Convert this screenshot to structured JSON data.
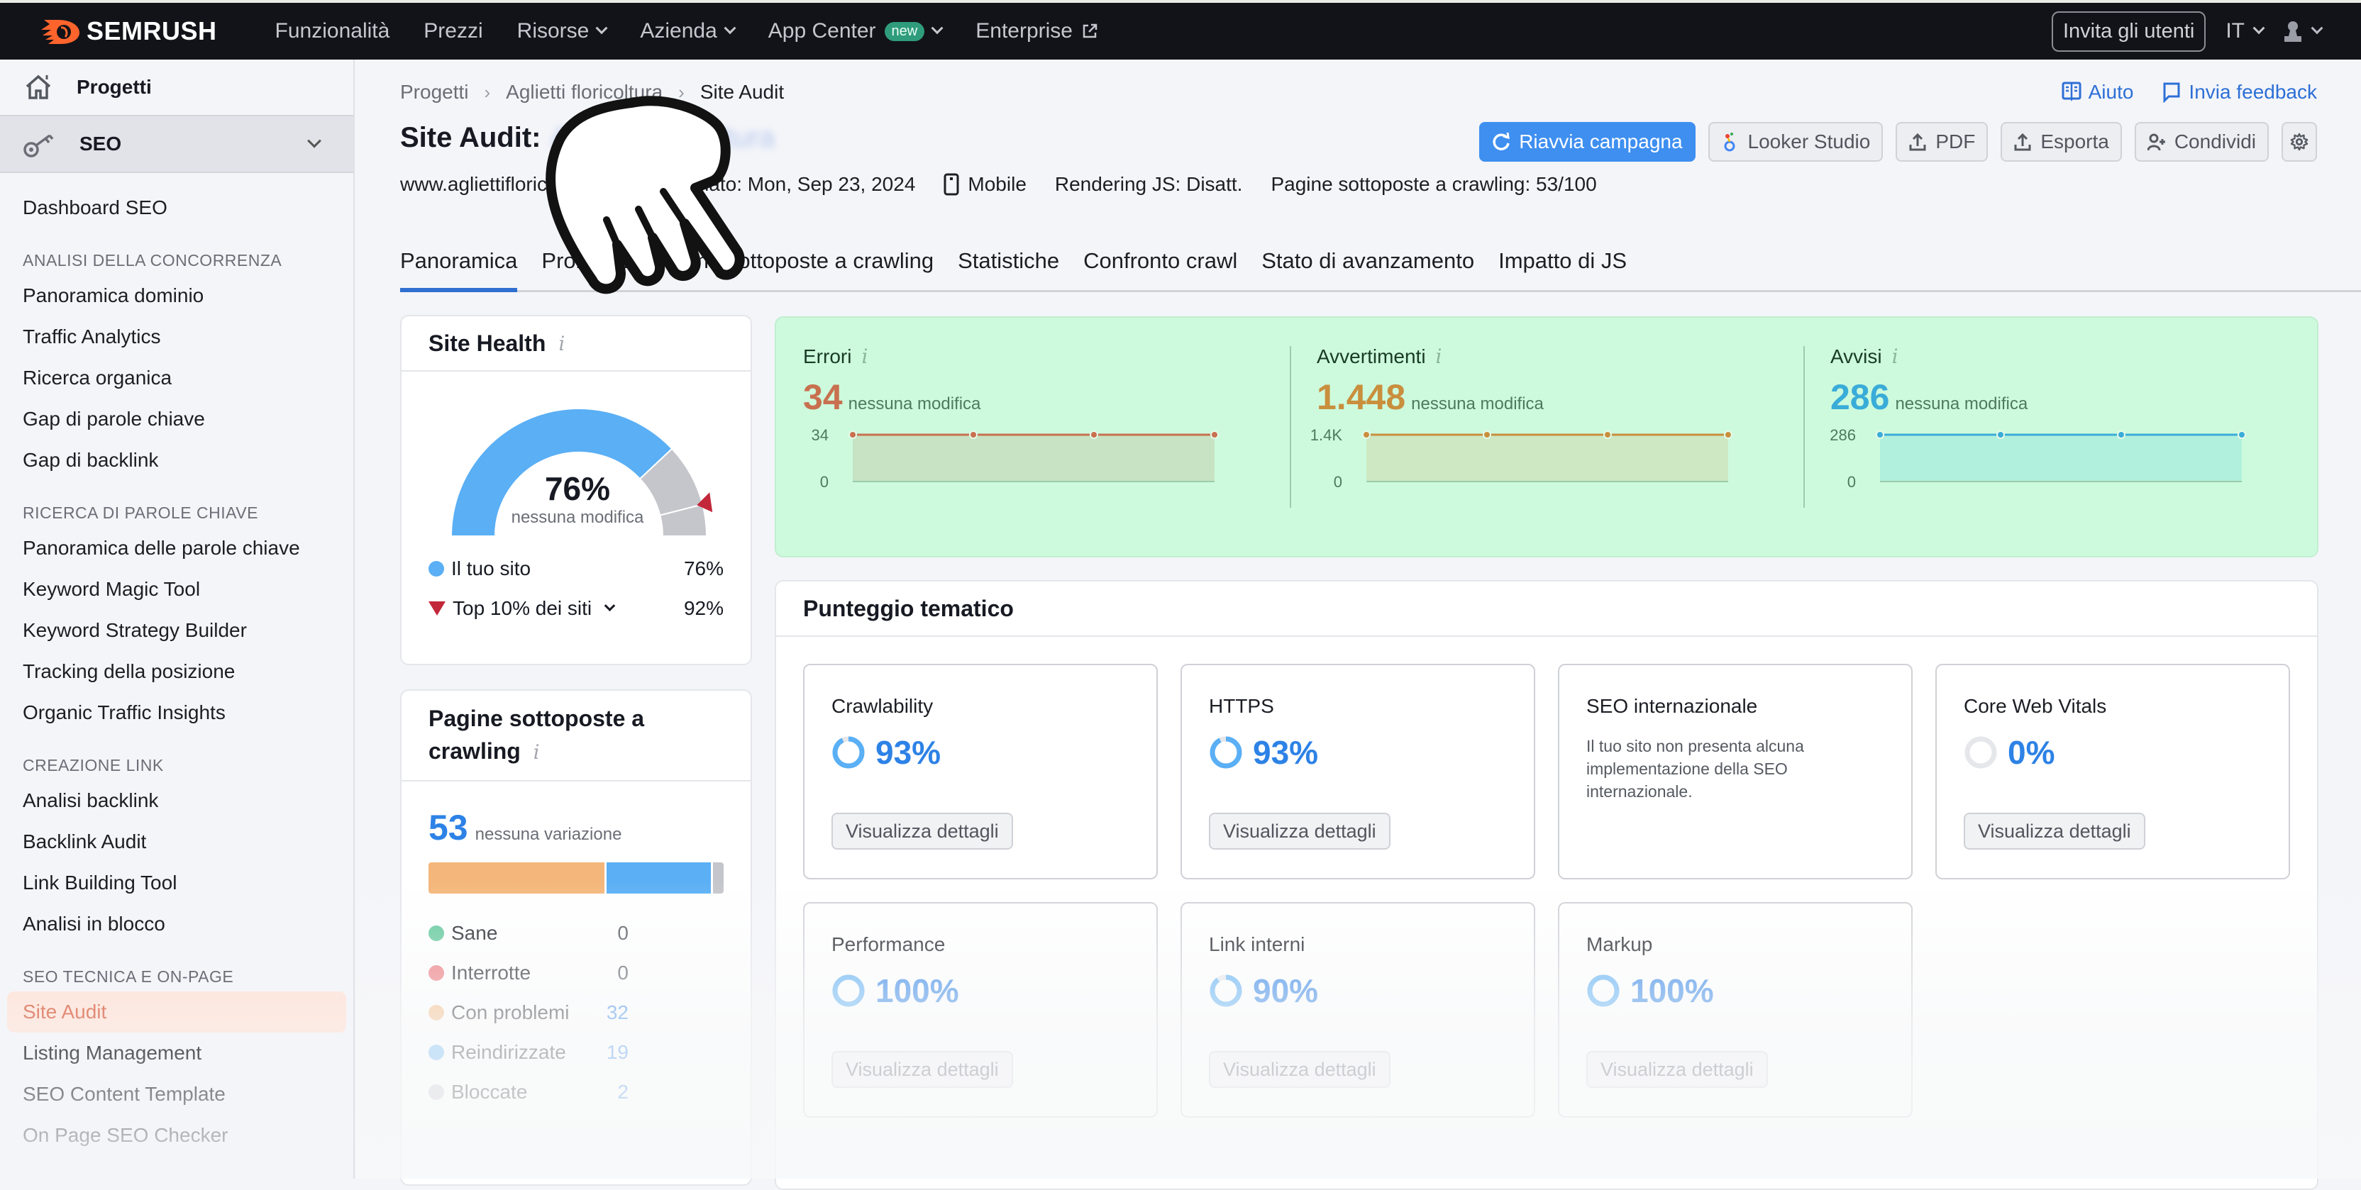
{
  "topnav": {
    "brand": "SEMRUSH",
    "brand_color": "#ff642d",
    "items": [
      {
        "label": "Funzionalità",
        "dropdown": false
      },
      {
        "label": "Prezzi",
        "dropdown": false
      },
      {
        "label": "Risorse",
        "dropdown": true
      },
      {
        "label": "Azienda",
        "dropdown": true
      },
      {
        "label": "App Center",
        "dropdown": true,
        "badge": "new"
      },
      {
        "label": "Enterprise",
        "external": true
      }
    ],
    "invite_label": "Invita gli utenti",
    "language": "IT",
    "user_icon": "user-icon"
  },
  "sidebar": {
    "projects_label": "Progetti",
    "seo_label": "SEO",
    "dashboard": "Dashboard SEO",
    "sections": [
      {
        "title": "ANALISI DELLA CONCORRENZA",
        "items": [
          "Panoramica dominio",
          "Traffic Analytics",
          "Ricerca organica",
          "Gap di parole chiave",
          "Gap di backlink"
        ]
      },
      {
        "title": "RICERCA DI PAROLE CHIAVE",
        "items": [
          "Panoramica delle parole chiave",
          "Keyword Magic Tool",
          "Keyword Strategy Builder",
          "Tracking della posizione",
          "Organic Traffic Insights"
        ]
      },
      {
        "title": "CREAZIONE LINK",
        "items": [
          "Analisi backlink",
          "Backlink Audit",
          "Link Building Tool",
          "Analisi in blocco"
        ]
      },
      {
        "title": "SEO TECNICA E ON-PAGE",
        "items": [
          "Site Audit",
          "Listing Management",
          "SEO Content Template",
          "On Page SEO Checker"
        ]
      }
    ],
    "active_item": "Site Audit",
    "active_color": "#e0826a"
  },
  "header": {
    "breadcrumb": [
      "Progetti",
      "Aglietti floricoltura",
      "Site Audit"
    ],
    "help_label": "Aiuto",
    "feedback_label": "Invia feedback",
    "title_prefix": "Site Audit:",
    "title_project": "Aglietti floricoltura",
    "domain": "www.agliettifloricoltura.it",
    "updated": "Aggiornato: Mon, Sep 23, 2024",
    "device": "Mobile",
    "js_rendering": "Rendering JS: Disatt.",
    "crawled_pages": "Pagine sottoposte a crawling: 53/100",
    "actions": {
      "restart": "Riavvia campagna",
      "looker": "Looker Studio",
      "pdf": "PDF",
      "export": "Esporta",
      "share": "Condividi"
    },
    "primary_color": "#3e8ff0"
  },
  "tabs": [
    "Panoramica",
    "Problemi",
    "Pagine sottoposte a crawling",
    "Statistiche",
    "Confronto crawl",
    "Stato di avanzamento",
    "Impatto di JS"
  ],
  "active_tab": 0,
  "site_health": {
    "title": "Site Health",
    "value": "76%",
    "value_fraction": 0.76,
    "top10_fraction": 0.92,
    "change": "nessuna modifica",
    "legend": [
      {
        "label": "Il tuo sito",
        "value": "76%"
      },
      {
        "label": "Top 10% dei siti",
        "value": "92%"
      }
    ],
    "colors": {
      "site": "#5aaff5",
      "rest": "#c5c6cb",
      "marker": "#c2283a"
    }
  },
  "crawled": {
    "title": "Pagine sottoposte a crawling",
    "total": "53",
    "change": "nessuna variazione",
    "rows": [
      {
        "label": "Sane",
        "value": 0,
        "color": "#5fc79a",
        "value_color": "#555960"
      },
      {
        "label": "Interrotte",
        "value": 0,
        "color": "#ee7278",
        "value_color": "#555960"
      },
      {
        "label": "Con problemi",
        "value": 32,
        "color": "#f4b67a",
        "value_color": "#2d82e6"
      },
      {
        "label": "Reindirizzate",
        "value": 19,
        "color": "#5aaff5",
        "value_color": "#2d82e6"
      },
      {
        "label": "Bloccate",
        "value": 2,
        "color": "#c5c6cb",
        "value_color": "#2d82e6"
      }
    ]
  },
  "issues": [
    {
      "title": "Errori",
      "count": "34",
      "change": "nessuna modifica",
      "color": "#c8704f",
      "fill": "#c7e3c3",
      "ticks": [
        "34",
        "0"
      ],
      "points": [
        34,
        34,
        34,
        34
      ],
      "max": 34
    },
    {
      "title": "Avvertimenti",
      "count": "1.448",
      "change": "nessuna modifica",
      "color": "#c98f3d",
      "fill": "#cde8c2",
      "ticks": [
        "1.4K",
        "0"
      ],
      "points": [
        1448,
        1448,
        1448,
        1448
      ],
      "max": 1448
    },
    {
      "title": "Avvisi",
      "count": "286",
      "change": "nessuna modifica",
      "color": "#3aacd8",
      "fill": "#b1f0dd",
      "ticks": [
        "286",
        "0"
      ],
      "points": [
        286,
        286,
        286,
        286
      ],
      "max": 286
    }
  ],
  "thematic": {
    "title": "Punteggio tematico",
    "details_label": "Visualizza dettagli",
    "items": [
      {
        "name": "Crawlability",
        "score": "93%",
        "fraction": 0.93
      },
      {
        "name": "HTTPS",
        "score": "93%",
        "fraction": 0.93
      },
      {
        "name": "SEO internazionale",
        "description": "Il tuo sito non presenta alcuna implementazione della SEO internazionale."
      },
      {
        "name": "Core Web Vitals",
        "score": "0%",
        "fraction": 0
      },
      {
        "name": "Performance",
        "score": "100%",
        "fraction": 1
      },
      {
        "name": "Link interni",
        "score": "90%",
        "fraction": 0.9
      },
      {
        "name": "Markup",
        "score": "100%",
        "fraction": 1
      }
    ]
  }
}
